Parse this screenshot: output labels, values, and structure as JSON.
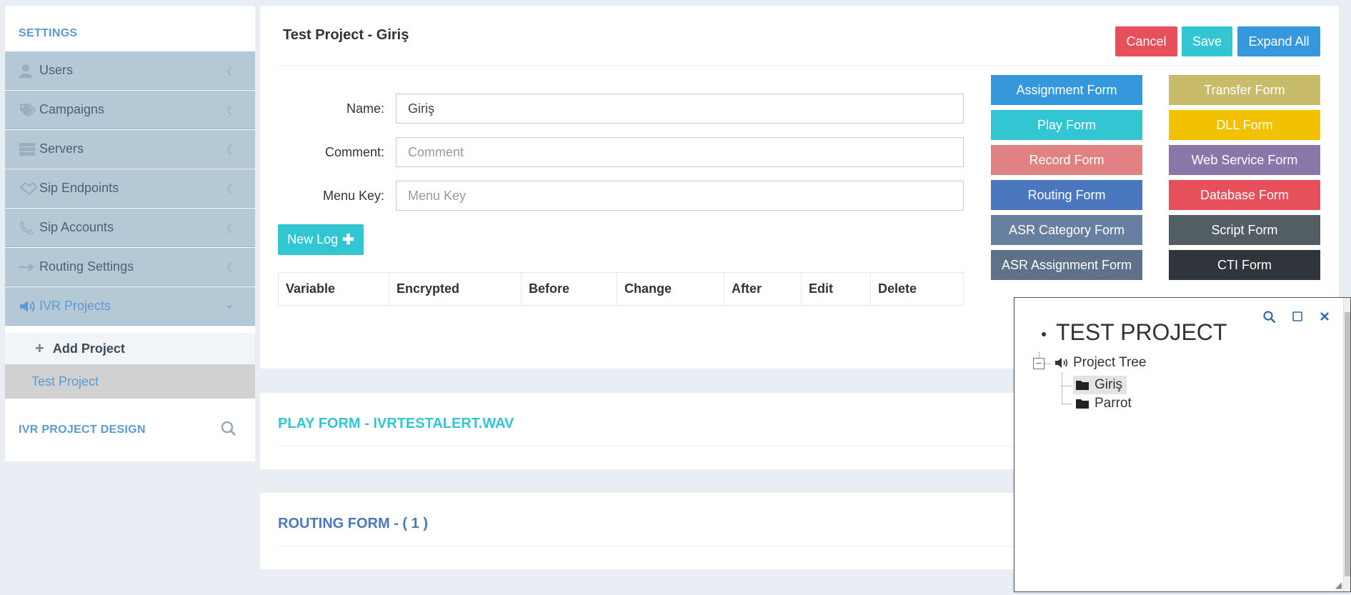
{
  "sidebar": {
    "title": "SETTINGS",
    "items": [
      {
        "label": "Users",
        "icon": "user-icon",
        "active": false
      },
      {
        "label": "Campaigns",
        "icon": "tags-icon",
        "active": false
      },
      {
        "label": "Servers",
        "icon": "server-icon",
        "active": false
      },
      {
        "label": "Sip Endpoints",
        "icon": "handshake-icon",
        "active": false
      },
      {
        "label": "Sip Accounts",
        "icon": "phone-icon",
        "active": false
      },
      {
        "label": "Routing Settings",
        "icon": "arrow-right-icon",
        "active": false
      },
      {
        "label": "IVR Projects",
        "icon": "volume-icon",
        "active": true
      }
    ],
    "add_project": "Add Project",
    "project": "Test Project",
    "footer_title": "IVR PROJECT DESIGN"
  },
  "main": {
    "title": "Test Project - Giriş",
    "buttons": {
      "cancel": "Cancel",
      "save": "Save",
      "expand_all": "Expand All"
    },
    "form": {
      "name_label": "Name:",
      "name_value": "Giriş",
      "comment_label": "Comment:",
      "comment_placeholder": "Comment",
      "menu_key_label": "Menu Key:",
      "menu_key_placeholder": "Menu Key"
    },
    "new_log": "New Log",
    "log_columns": [
      "Variable",
      "Encrypted",
      "Before",
      "Change",
      "After",
      "Edit",
      "Delete"
    ],
    "form_buttons": {
      "assignment": "Assignment Form",
      "transfer": "Transfer Form",
      "play": "Play Form",
      "dll": "DLL Form",
      "record": "Record Form",
      "web_service": "Web Service Form",
      "routing": "Routing Form",
      "database": "Database Form",
      "asr_category": "ASR Category Form",
      "script": "Script Form",
      "asr_assignment": "ASR Assignment Form",
      "cti": "CTI Form"
    }
  },
  "panels": {
    "play_title": "PLAY FORM - IVRTESTALERT.WAV",
    "routing_title": "ROUTING FORM - ( 1 )"
  },
  "tree": {
    "root": "TEST PROJECT",
    "project_tree": "Project Tree",
    "children": [
      "Giriş",
      "Parrot"
    ],
    "selected": "Giriş"
  },
  "colors": {
    "accent_blue": "#3598dc",
    "cancel_red": "#e7505a",
    "teal": "#32c5d2",
    "title_teal": "#32c5d2",
    "title_blue": "#4b77be",
    "sidebar_item": "#b5c8d6"
  }
}
